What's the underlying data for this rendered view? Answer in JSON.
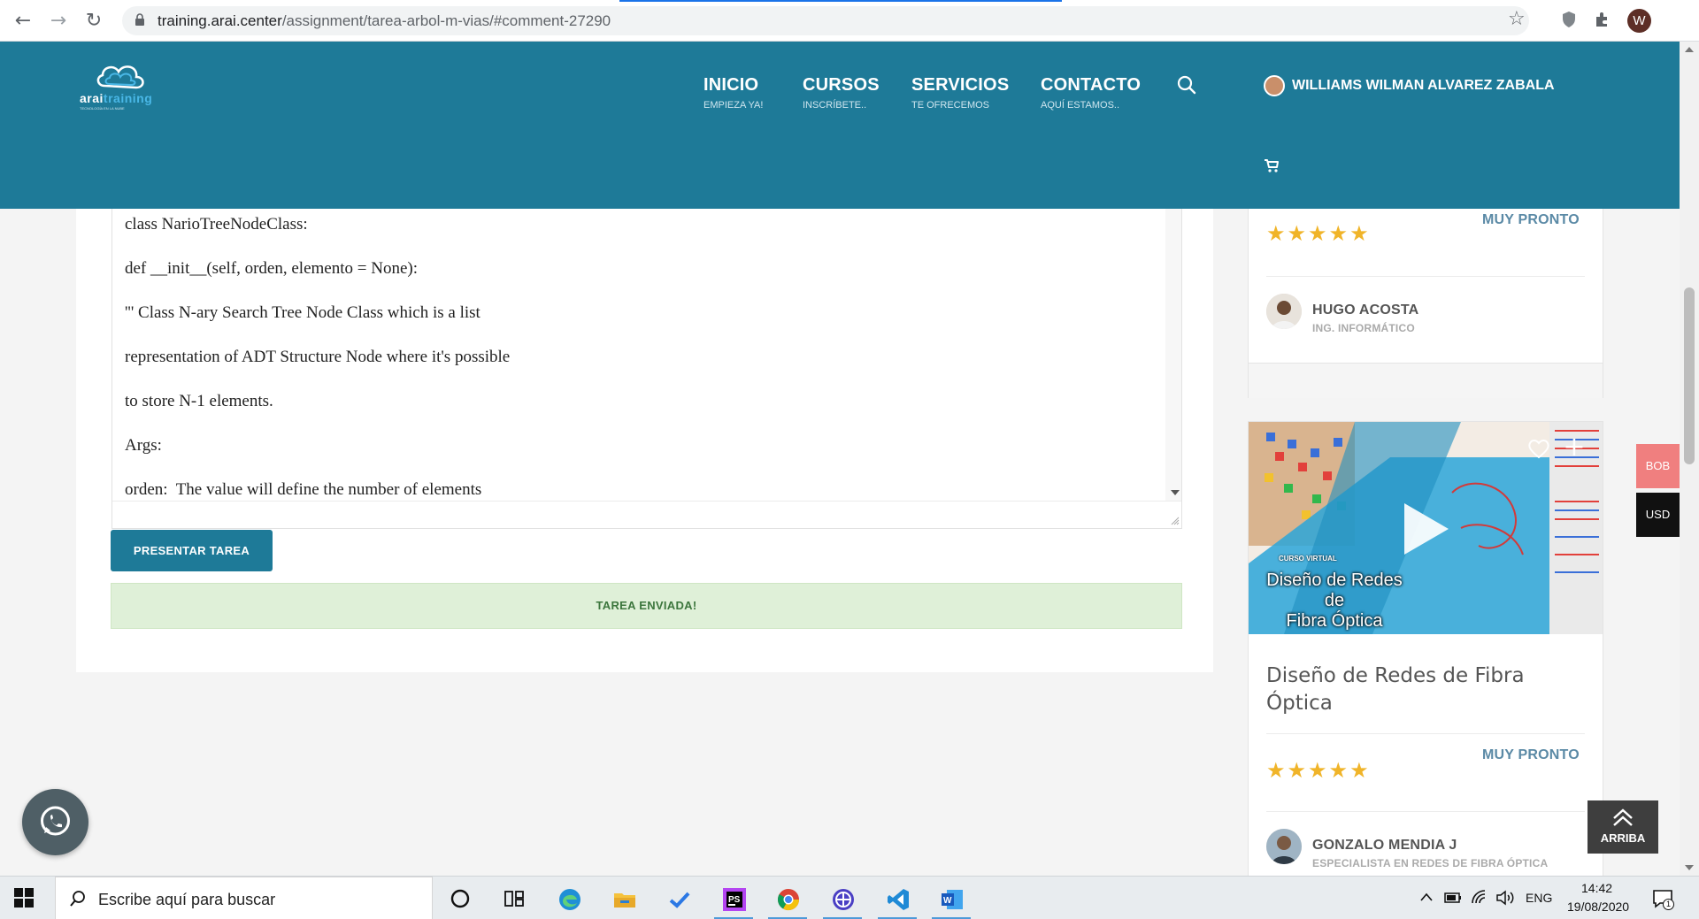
{
  "browser": {
    "url_host": "training.arai.center",
    "url_path": "/assignment/tarea-arbol-m-vias/#comment-27290",
    "profile_initial": "W"
  },
  "header": {
    "logo_text_main": "arai",
    "logo_text_accent": "training",
    "logo_tagline": "TECNOLOGÍA EN LA NUBE",
    "menu": [
      {
        "title": "INICIO",
        "subtitle": "EMPIEZA YA!"
      },
      {
        "title": "CURSOS",
        "subtitle": "INSCRÍBETE.."
      },
      {
        "title": "SERVICIOS",
        "subtitle": "TE OFRECEMOS"
      },
      {
        "title": "CONTACTO",
        "subtitle": "AQUÍ ESTAMOS.."
      }
    ],
    "user_name": "WILLIAMS WILMAN ALVAREZ ZABALA",
    "brand_color": "#1e7a98"
  },
  "editor": {
    "lines": [
      "class NarioTreeNodeClass:",
      "def __init__(self, orden, elemento = None):",
      "''' Class N-ary Search Tree Node Class which is a list",
      "representation of ADT Structure Node where it's possible",
      "to store N-1 elements.",
      "Args:",
      "orden:  The value will define the number of elements"
    ]
  },
  "actions": {
    "submit_label": "PRESENTAR TAREA",
    "success_message": "TAREA ENVIADA!"
  },
  "sidebar": {
    "card_a": {
      "status": "MUY PRONTO",
      "rating_stars": "★★★★★",
      "rating": 5,
      "teacher_name": "HUGO ACOSTA",
      "teacher_role": "ING. INFORMÁTICO"
    },
    "card_b": {
      "thumb_kicker": "CURSO VIRTUAL",
      "thumb_title_lines": [
        "Diseño de Redes",
        "de",
        "Fibra Óptica"
      ],
      "title": "Diseño de Redes de Fibra Óptica",
      "status": "MUY PRONTO",
      "rating_stars": "★★★★★",
      "rating": 5,
      "teacher_name": "GONZALO MENDIA J",
      "teacher_role": "ESPECIALISTA EN REDES DE FIBRA ÓPTICA"
    }
  },
  "widgets": {
    "currency_bob": "BOB",
    "currency_usd": "USD",
    "back_to_top": "ARRIBA"
  },
  "taskbar": {
    "search_placeholder": "Escribe aquí para buscar",
    "language": "ENG",
    "time": "14:42",
    "date": "19/08/2020",
    "notification_count": "1"
  }
}
